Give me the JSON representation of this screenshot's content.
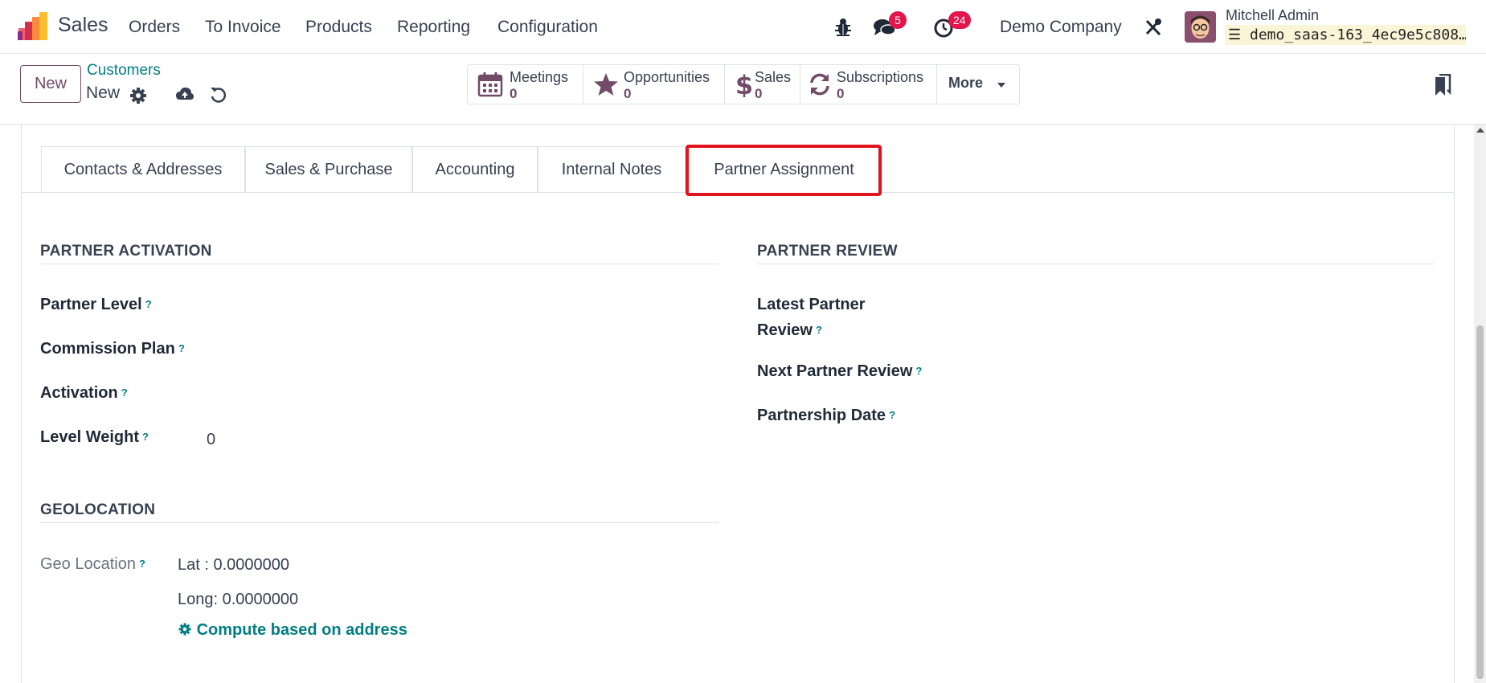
{
  "navbar": {
    "app_name": "Sales",
    "menu": [
      "Orders",
      "To Invoice",
      "Products",
      "Reporting",
      "Configuration"
    ],
    "messages_count": "5",
    "activities_count": "24",
    "company": "Demo Company",
    "user_name": "Mitchell Admin",
    "database": "demo_saas-163_4ec9e5c808…"
  },
  "control_panel": {
    "new_label": "New",
    "breadcrumb_parent": "Customers",
    "breadcrumb_current": "New",
    "smart_buttons": [
      {
        "label": "Meetings",
        "count": "0",
        "icon": "calendar-icon"
      },
      {
        "label": "Opportunities",
        "count": "0",
        "icon": "star-icon"
      },
      {
        "label": "Sales",
        "count": "0",
        "icon": "dollar-icon"
      },
      {
        "label": "Subscriptions",
        "count": "0",
        "icon": "refresh-icon"
      }
    ],
    "more_label": "More"
  },
  "tabs": [
    "Contacts & Addresses",
    "Sales & Purchase",
    "Accounting",
    "Internal Notes",
    "Partner Assignment"
  ],
  "active_tab": "Partner Assignment",
  "partner_activation": {
    "title": "PARTNER ACTIVATION",
    "partner_level_label": "Partner Level",
    "commission_plan_label": "Commission Plan",
    "activation_label": "Activation",
    "level_weight_label": "Level Weight",
    "level_weight_value": "0"
  },
  "partner_review": {
    "title": "PARTNER REVIEW",
    "latest_review_label_1": "Latest Partner",
    "latest_review_label_2": "Review",
    "next_review_label": "Next Partner Review",
    "partnership_date_label": "Partnership Date"
  },
  "geolocation": {
    "title": "GEOLOCATION",
    "geo_label": "Geo Location",
    "lat": "Lat : 0.0000000",
    "long": "Long: 0.0000000",
    "compute_label": "Compute based on address"
  },
  "help_mark": "?",
  "colors": {
    "brand": "#714b67",
    "link": "#017e84",
    "badge": "#e4154b",
    "highlight": "#e0141f"
  }
}
